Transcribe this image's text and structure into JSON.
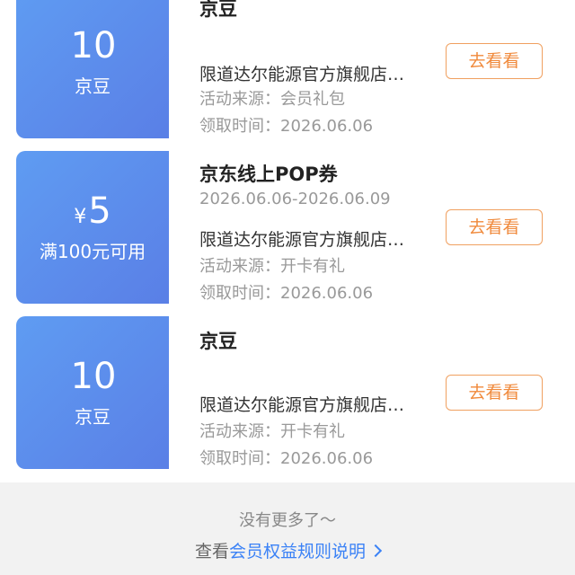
{
  "cards": [
    {
      "currency": "",
      "amount": "10",
      "unit": "京豆",
      "title": "京豆",
      "period": "",
      "store": "限道达尔能源官方旗舰店…",
      "source": "活动来源：会员礼包",
      "time": "领取时间：2026.06.06",
      "button": "去看看"
    },
    {
      "currency": "¥",
      "amount": "5",
      "unit": "满100元可用",
      "title": "京东线上POP券",
      "period": "2026.06.06-2026.06.09",
      "store": "限道达尔能源官方旗舰店…",
      "source": "活动来源：开卡有礼",
      "time": "领取时间：2026.06.06",
      "button": "去看看"
    },
    {
      "currency": "",
      "amount": "10",
      "unit": "京豆",
      "title": "京豆",
      "period": "",
      "store": "限道达尔能源官方旗舰店…",
      "source": "活动来源：开卡有礼",
      "time": "领取时间：2026.06.06",
      "button": "去看看"
    }
  ],
  "footer": {
    "no_more": "没有更多了～",
    "rules_prefix": "查看",
    "rules_link": "会员权益规则说明"
  },
  "colors": {
    "card_gradient_start": "#5f9cf2",
    "card_gradient_end": "#5a7fe6",
    "button_accent": "#f08a3c",
    "link": "#3b82f6"
  }
}
